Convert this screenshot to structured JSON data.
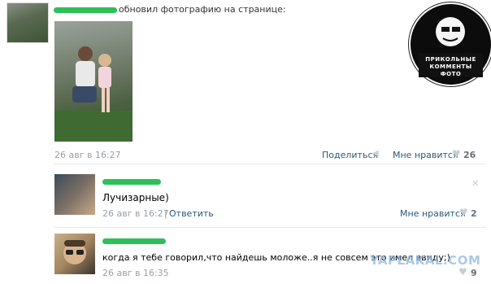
{
  "post": {
    "action_text": "обновил фотографию на странице:",
    "date": "26 авг в 16:27",
    "share_label": "Поделиться",
    "like_label": "Мне нравится",
    "like_count": "26"
  },
  "comments": [
    {
      "text": "Лучизарные)",
      "date": "26 авг в 16:27",
      "separator": "|",
      "reply_label": "Ответить",
      "like_label": "Мне нравится",
      "like_count": "2"
    },
    {
      "text": "когда я тебе говорил,что найдешь моложе..я не совсем это имел ввиду;)",
      "date": "26 авг в 16:35",
      "like_count": "9"
    }
  ],
  "icons": {
    "heart": "♥",
    "close": "✕"
  },
  "watermarks": {
    "badge_text": "ПРИКОЛЬНЫЕ КОММЕНТЫ ФОТО",
    "site": "YAPLAKAL.COM"
  },
  "colors": {
    "link": "#2b587a",
    "name_scribble": "#2fbf5a",
    "meta_gray": "#9aa0a6"
  }
}
